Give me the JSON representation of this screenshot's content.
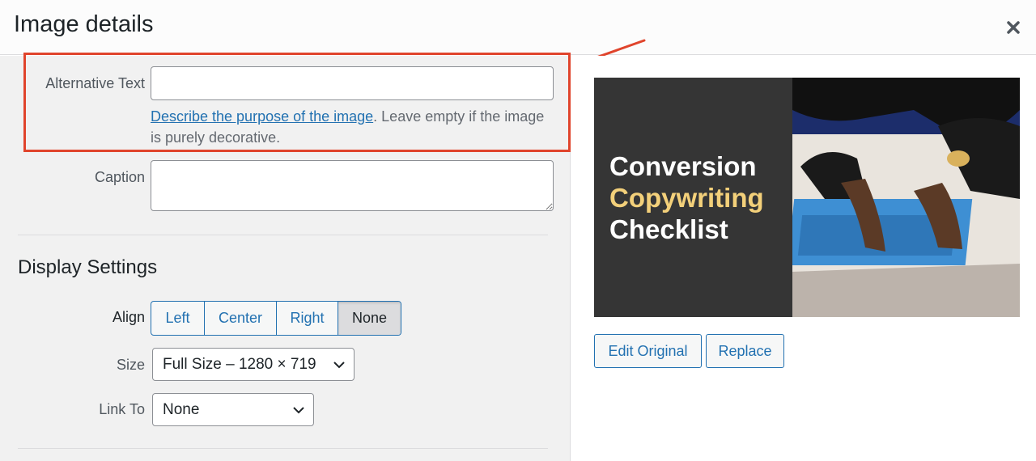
{
  "dialog": {
    "title": "Image details",
    "close_icon": "close-icon"
  },
  "alt_text": {
    "label": "Alternative Text",
    "value": "",
    "help_link": "Describe the purpose of the image",
    "help_rest": ". Leave empty if the image is purely decorative."
  },
  "caption": {
    "label": "Caption",
    "value": ""
  },
  "display_settings": {
    "title": "Display Settings",
    "align": {
      "label": "Align",
      "options": [
        "Left",
        "Center",
        "Right",
        "None"
      ],
      "selected": "None"
    },
    "size": {
      "label": "Size",
      "value": "Full Size – 1280 × 719"
    },
    "link_to": {
      "label": "Link To",
      "value": "None"
    }
  },
  "preview": {
    "line1": "Conversion",
    "line2": "Copywriting",
    "line3": "Checklist"
  },
  "actions": {
    "edit_original": "Edit Original",
    "replace": "Replace"
  },
  "colors": {
    "accent": "#2271b1",
    "highlight": "#e0442c",
    "thumb_accent": "#f3d07a"
  }
}
